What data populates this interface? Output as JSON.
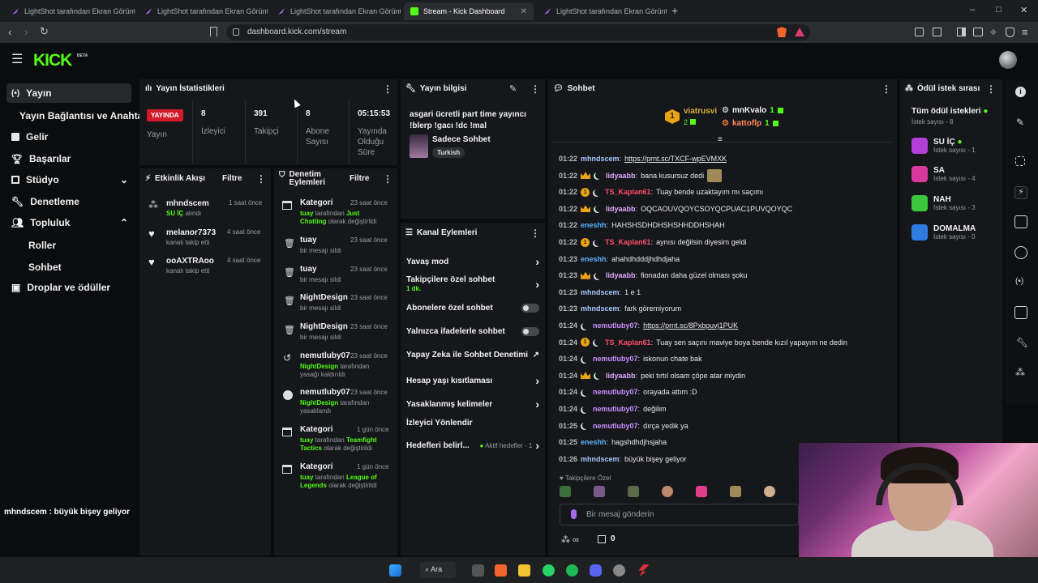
{
  "browser": {
    "tabs": [
      {
        "title": "LightShot tarafından Ekran Görüntüsü"
      },
      {
        "title": "LightShot tarafından Ekran Görüntüsü"
      },
      {
        "title": "LightShot tarafından Ekran Görüntüsü"
      },
      {
        "title": "Stream - Kick Dashboard"
      },
      {
        "title": "LightShot tarafından Ekran Görüntüsü"
      }
    ],
    "new_tab": "+",
    "url": "dashboard.kick.com/stream",
    "win_min": "–",
    "win_max": "□",
    "win_close": "✕"
  },
  "header": {
    "logo": "KICK",
    "beta": "BETA"
  },
  "sidebar": {
    "items": [
      {
        "label": "Yayın"
      },
      {
        "label": "Yayın Bağlantısı ve Anahtarı"
      },
      {
        "label": "Gelir"
      },
      {
        "label": "Başarılar"
      },
      {
        "label": "Stüdyo"
      },
      {
        "label": "Denetleme"
      },
      {
        "label": "Topluluk"
      },
      {
        "label": "Roller"
      },
      {
        "label": "Sohbet"
      },
      {
        "label": "Droplar ve ödüller"
      }
    ],
    "overlay_user": "mhndscem",
    "overlay_msg": " : büyük bişey geliyor"
  },
  "stats": {
    "title": "Yayın İstatistikleri",
    "live_badge": "YAYINDA",
    "live_label": "Yayın",
    "viewers_num": "8",
    "viewers_lbl": "İzleyici",
    "followers_num": "391",
    "followers_lbl": "Takipçi",
    "subs_num": "8",
    "subs_lbl1": "Abone",
    "subs_lbl2": "Sayısı",
    "uptime_num": "05:15:53",
    "uptime_lbl1": "Yayında",
    "uptime_lbl2": "Olduğu",
    "uptime_lbl3": "Süre"
  },
  "activity": {
    "title": "Etkinlik Akışı",
    "filter": "Filtre",
    "items": [
      {
        "name": "mhndscem",
        "time": "1 saat önce",
        "sub_green": "SU İÇ",
        "sub": " alındı"
      },
      {
        "name": "melanor7373",
        "time": "4 saat önce",
        "sub": "kanalı takip etti"
      },
      {
        "name": "ooAXTRAoo",
        "time": "4 saat önce",
        "sub": "kanalı takip etti"
      }
    ]
  },
  "modlog": {
    "title1": "Denetim",
    "title2": "Eylemleri",
    "filter": "Filtre",
    "items": [
      {
        "name": "Kategori",
        "time": "23 saat önce",
        "l1a": "tuay",
        "l1b": " tarafından ",
        "l1c": "Just",
        "l2a": "Chatting",
        "l2b": " olarak değiştirildi"
      },
      {
        "name": "tuay",
        "time": "23 saat önce",
        "l1": "bir mesajı sildi"
      },
      {
        "name": "tuay",
        "time": "23 saat önce",
        "l1": "bir mesajı sildi"
      },
      {
        "name": "NightDesign",
        "time": "23 saat önce",
        "l1": "bir mesajı sildi"
      },
      {
        "name": "NightDesign",
        "time": "23 saat önce",
        "l1": "bir mesajı sildi"
      },
      {
        "name": "nemutluby07",
        "time": "23 saat önce",
        "l1a": "NightDesign",
        "l1b": " tarafından",
        "l2": "yasağı kaldırıldı"
      },
      {
        "name": "nemutluby07",
        "time": "23 saat önce",
        "l1a": "NightDesign",
        "l1b": " tarafından",
        "l2": "yasaklandı"
      },
      {
        "name": "Kategori",
        "time": "1 gün önce",
        "l1a": "tuay",
        "l1b": " tarafından ",
        "l1c": "Teamfight",
        "l2a": "Tactics",
        "l2b": " olarak değiştirildi"
      },
      {
        "name": "Kategori",
        "time": "1 gün önce",
        "l1a": "tuay",
        "l1b": " tarafından ",
        "l1c": "League of",
        "l2a": "Legends",
        "l2b": " olarak değiştirildi"
      }
    ]
  },
  "streaminfo": {
    "title": "Yayın bilgisi",
    "line1": "asgari ücretli part time yayıncı",
    "line2": "!blerp !gacı !dc !mal",
    "category": "Sadece Sohbet",
    "tag": "Turkish"
  },
  "channel_actions": {
    "title": "Kanal Eylemleri",
    "slow": "Yavaş mod",
    "followers": "Takipçilere özel sohbet",
    "followers_sub": "1 dk.",
    "subs": "Abonelere özel sohbet",
    "emotes": "Yalnızca ifadelerle sohbet",
    "ai": "Yapay Zeka ile Sohbet Denetimi",
    "age": "Hesap yaşı kısıtlaması",
    "banned": "Yasaklanmış kelimeler",
    "redirect": "İzleyici Yönlendir",
    "goals": "Hedefleri belirl...",
    "goals_status": "Aktif hedefler - 1"
  },
  "chat": {
    "title": "Sohbet",
    "top1_name": "viatrusvi",
    "top1_count": "2",
    "top2_name": "mnKvalo",
    "top2_count": "1",
    "top3_name": "kattoflp",
    "top3_count": "1",
    "messages": [
      {
        "time": "01:22",
        "user": "mhndscem",
        "color": "#a6c8ff",
        "badges": "",
        "text": "",
        "link": "https://prnt.sc/TXCF-wpEVMXK"
      },
      {
        "time": "01:22",
        "user": "lidyaabb",
        "color": "#e0a8ff",
        "badges": "cm",
        "text": "bana kusursuz dedi"
      },
      {
        "time": "01:22",
        "user": "TS_Kaplan61",
        "color": "#ff4d6d",
        "badges": "gm",
        "text": "Tuay bende uzaktayım mı saçımı"
      },
      {
        "time": "01:22",
        "user": "lidyaabb",
        "color": "#e0a8ff",
        "badges": "cm",
        "text": "OQCAOUVQOYCSOYQCPUAC1PUVQOYQC"
      },
      {
        "time": "01:22",
        "user": "eneshh",
        "color": "#5ab0ff",
        "badges": "",
        "text": "HAHSHSDHDHSHSHHDDHSHAH"
      },
      {
        "time": "01:22",
        "user": "TS_Kaplan61",
        "color": "#ff4d6d",
        "badges": "gm",
        "text": "aynısı değilsin diyesim geldi"
      },
      {
        "time": "01:23",
        "user": "eneshh",
        "color": "#5ab0ff",
        "badges": "",
        "text": "ahahdhdddjhdhdjaha"
      },
      {
        "time": "01:23",
        "user": "lidyaabb",
        "color": "#e0a8ff",
        "badges": "cm",
        "text": "fionadan daha güzel olması şoku"
      },
      {
        "time": "01:23",
        "user": "mhndscem",
        "color": "#a6c8ff",
        "badges": "",
        "text": "1 e 1"
      },
      {
        "time": "01:23",
        "user": "mhndscem",
        "color": "#a6c8ff",
        "badges": "",
        "text": "fark göremiyorum"
      },
      {
        "time": "01:24",
        "user": "nemutluby07",
        "color": "#c890ff",
        "badges": "m",
        "text": "",
        "link": "https://prnt.sc/8Pxbpuvj1PUK"
      },
      {
        "time": "01:24",
        "user": "TS_Kaplan61",
        "color": "#ff4d6d",
        "badges": "gm",
        "text": "Tuay sen saçını maviye boya bende kızıl yapayım ne dedin"
      },
      {
        "time": "01:24",
        "user": "nemutluby07",
        "color": "#c890ff",
        "badges": "m",
        "text": "iskonun chate bak"
      },
      {
        "time": "01:24",
        "user": "lidyaabb",
        "color": "#e0a8ff",
        "badges": "cm",
        "text": "peki tırtıl olsam çöpe atar miydin"
      },
      {
        "time": "01:24",
        "user": "nemutluby07",
        "color": "#c890ff",
        "badges": "m",
        "text": "orayada attım :D"
      },
      {
        "time": "01:24",
        "user": "nemutluby07",
        "color": "#c890ff",
        "badges": "m",
        "text": "değilim"
      },
      {
        "time": "01:25",
        "user": "nemutluby07",
        "color": "#c890ff",
        "badges": "m",
        "text": "dırça yedik ya"
      },
      {
        "time": "01:25",
        "user": "eneshh",
        "color": "#5ab0ff",
        "badges": "",
        "text": "hagshdhdjhsjaha"
      },
      {
        "time": "01:26",
        "user": "mhndscem",
        "color": "#a6c8ff",
        "badges": "",
        "text": "büyük bişey geliyor"
      }
    ],
    "followers_only": "Takipçilere Özel",
    "input_placeholder": "Bir mesaj gönderin",
    "points": "0"
  },
  "rewards": {
    "title": "Ödül istek sırası",
    "all": "Tüm ödül istekleri",
    "all_sub": "İstek sayısı - 8",
    "items": [
      {
        "name": "SU İÇ",
        "sub": "İstek sayısı - 1",
        "color": "#b23ed8"
      },
      {
        "name": "SA",
        "sub": "İstek sayısı - 4",
        "color": "#d9389c"
      },
      {
        "name": "NAH",
        "sub": "İstek sayısı - 3",
        "color": "#3bc63b"
      },
      {
        "name": "DOMALMA",
        "sub": "İstek sayısı - 0",
        "color": "#2f7be0"
      }
    ]
  },
  "taskbar": {
    "search": "Ara"
  }
}
